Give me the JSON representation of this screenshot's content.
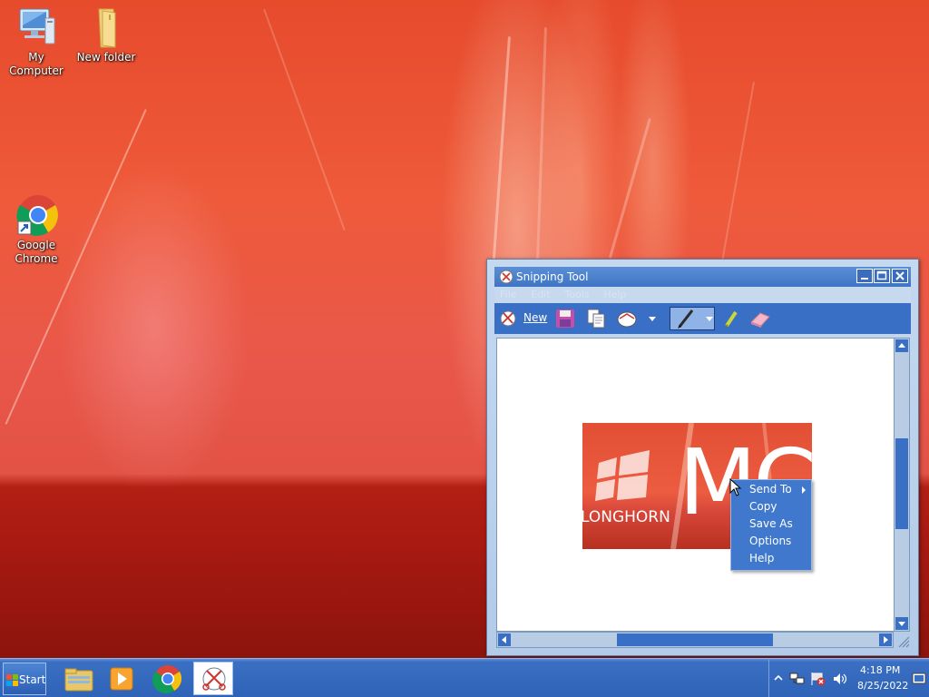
{
  "desktop": {
    "icons": [
      {
        "label": "My Computer"
      },
      {
        "label": "New folder"
      },
      {
        "label_line1": "Google",
        "label_line2": "Chrome"
      }
    ]
  },
  "window": {
    "title": "Snipping Tool",
    "menu": [
      "File",
      "Edit",
      "Tools",
      "Help"
    ],
    "toolbar": {
      "new_label": "New"
    },
    "snip_image": {
      "text": "LONGHORN",
      "big_text": "MC"
    }
  },
  "context_menu": {
    "items": [
      "Send To",
      "Copy",
      "Save As",
      "Options",
      "Help"
    ]
  },
  "taskbar": {
    "start_label": "Start",
    "clock_time": "4:18 PM",
    "clock_date": "8/25/2022"
  },
  "colors": {
    "accent": "#3a6fc6",
    "title_bar": "#4a82cf",
    "menu_bg": "#3f78cc"
  }
}
